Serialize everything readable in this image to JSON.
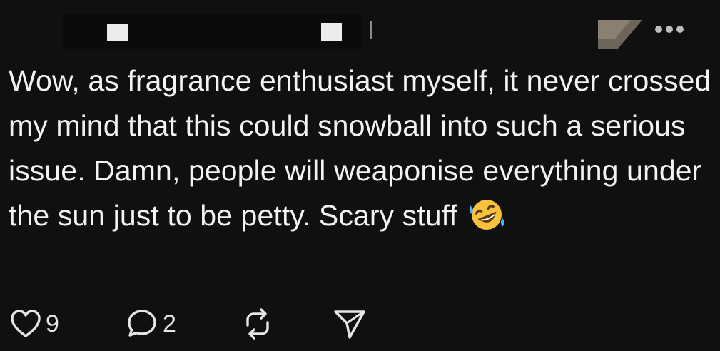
{
  "post": {
    "text": "Wow, as fragrance enthusiast myself, it never crossed my mind that this could snowball into such a serious issue. Damn, people will weaponise everything under the sun just to be petty. Scary stuff",
    "emoji": "rolling-on-the-floor-laughing-emoji"
  },
  "actions": {
    "likes": "9",
    "replies": "2"
  },
  "icons": {
    "like": "heart-icon",
    "reply": "speech-bubble-icon",
    "repost": "repost-icon",
    "share": "send-icon",
    "more": "more-horizontal-icon"
  },
  "colors": {
    "background": "#101010",
    "text": "#f3f3f3",
    "icon": "#e6e6e6",
    "emoji": "#f6c23b"
  }
}
